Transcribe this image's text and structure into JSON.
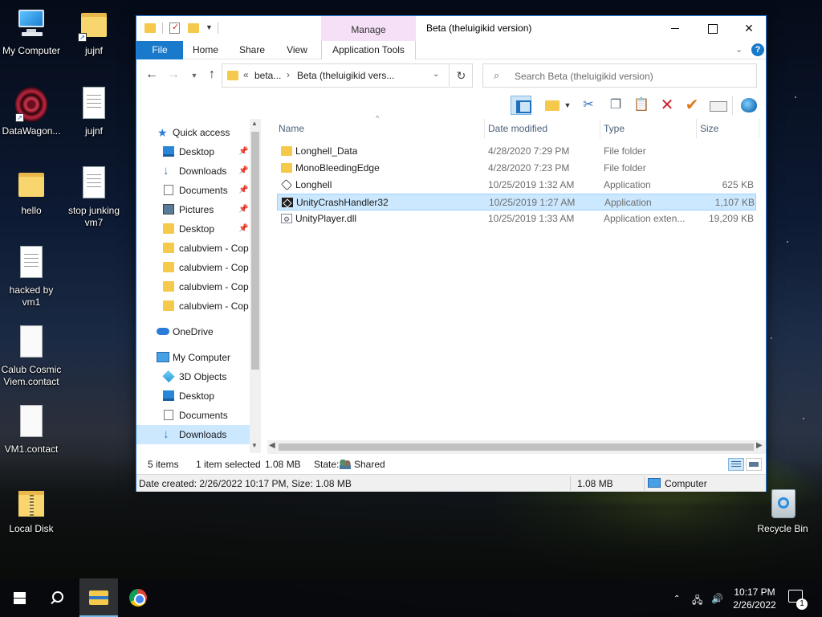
{
  "desktop": {
    "icons": [
      {
        "label": "My Computer",
        "icon": "computer-icon"
      },
      {
        "label": "jujnf",
        "icon": "folder-shortcut-icon"
      },
      {
        "label": "DataWagon...",
        "icon": "datawagon-icon"
      },
      {
        "label": "jujnf",
        "icon": "text-document-icon"
      },
      {
        "label": "hello",
        "icon": "folder-icon"
      },
      {
        "label": "stop junking vm7",
        "icon": "text-document-icon"
      },
      {
        "label": "hacked by vm1",
        "icon": "text-document-icon"
      },
      {
        "label": "Calub Cosmic Viem.contact",
        "icon": "contact-file-icon"
      },
      {
        "label": "VM1.contact",
        "icon": "contact-file-icon"
      },
      {
        "label": "Local Disk",
        "icon": "zip-folder-icon"
      },
      {
        "label": "Recycle Bin",
        "icon": "recycle-bin-icon"
      }
    ]
  },
  "window": {
    "title": "Beta (theluigikid version)",
    "manage_label": "Manage",
    "ribbon_tabs": {
      "file": "File",
      "home": "Home",
      "share": "Share",
      "view": "View",
      "app_tools": "Application Tools"
    },
    "address": {
      "prefix": "«",
      "crumb1": "beta...",
      "crumb2": "Beta (theluigikid vers..."
    },
    "search_placeholder": "Search Beta (theluigikid version)",
    "nav_pane": [
      {
        "label": "Quick access",
        "icon": "star-icon",
        "indent": 0
      },
      {
        "label": "Desktop",
        "icon": "desktop-icon",
        "pinned": true
      },
      {
        "label": "Downloads",
        "icon": "downloads-icon",
        "pinned": true
      },
      {
        "label": "Documents",
        "icon": "documents-icon",
        "pinned": true
      },
      {
        "label": "Pictures",
        "icon": "pictures-icon",
        "pinned": true
      },
      {
        "label": "Desktop",
        "icon": "folder-icon",
        "pinned": true
      },
      {
        "label": "calubviem - Cop",
        "icon": "folder-icon"
      },
      {
        "label": "calubviem - Cop",
        "icon": "folder-icon"
      },
      {
        "label": "calubviem - Cop",
        "icon": "folder-icon"
      },
      {
        "label": "calubviem - Cop",
        "icon": "folder-icon"
      },
      {
        "label": "OneDrive",
        "icon": "onedrive-icon",
        "indent": 0
      },
      {
        "label": "My Computer",
        "icon": "computer-icon",
        "indent": 0
      },
      {
        "label": "3D Objects",
        "icon": "3d-objects-icon"
      },
      {
        "label": "Desktop",
        "icon": "desktop-icon"
      },
      {
        "label": "Documents",
        "icon": "documents-icon"
      },
      {
        "label": "Downloads",
        "icon": "downloads-icon",
        "selected": true
      }
    ],
    "columns": {
      "name": "Name",
      "date": "Date modified",
      "type": "Type",
      "size": "Size"
    },
    "files": [
      {
        "name": "Longhell_Data",
        "date": "4/28/2020 7:29 PM",
        "type": "File folder",
        "size": "",
        "icon": "folder-icon"
      },
      {
        "name": "MonoBleedingEdge",
        "date": "4/28/2020 7:23 PM",
        "type": "File folder",
        "size": "",
        "icon": "folder-icon"
      },
      {
        "name": "Longhell",
        "date": "10/25/2019 1:32 AM",
        "type": "Application",
        "size": "625 KB",
        "icon": "unity-app-icon"
      },
      {
        "name": "UnityCrashHandler32",
        "date": "10/25/2019 1:27 AM",
        "type": "Application",
        "size": "1,107 KB",
        "icon": "application-icon",
        "selected": true
      },
      {
        "name": "UnityPlayer.dll",
        "date": "10/25/2019 1:33 AM",
        "type": "Application exten...",
        "size": "19,209 KB",
        "icon": "dll-icon"
      }
    ],
    "status": {
      "count": "5 items",
      "selected": "1 item selected",
      "size": "1.08 MB",
      "state_label": "State:",
      "state_value": "Shared"
    },
    "details": {
      "info": "Date created: 2/26/2022 10:17 PM, Size: 1.08 MB",
      "size": "1.08 MB",
      "location": "Computer"
    }
  },
  "taskbar": {
    "time": "10:17 PM",
    "date": "2/26/2022",
    "notification_count": "1"
  }
}
